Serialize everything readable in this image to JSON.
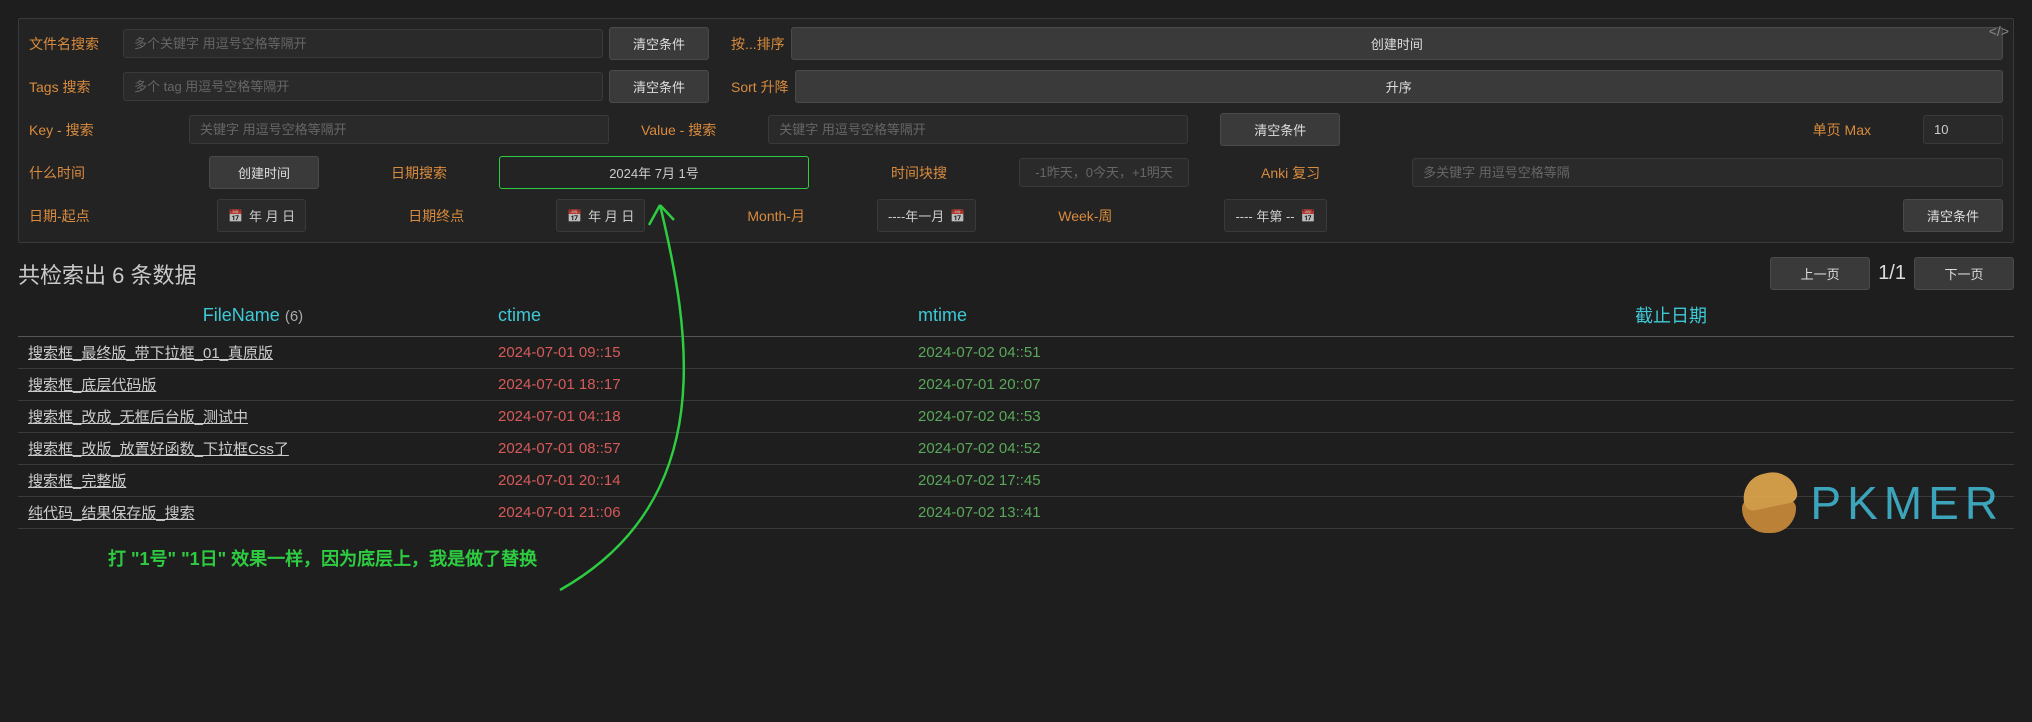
{
  "filters": {
    "filename_label": "文件名搜索",
    "filename_placeholder": "多个关键字 用逗号空格等隔开",
    "tags_label": "Tags 搜索",
    "tags_placeholder": "多个 tag 用逗号空格等隔开",
    "clear_btn": "清空条件",
    "sort_by_label": "按...排序",
    "sort_by_value": "创建时间",
    "sort_dir_label": "Sort 升降",
    "sort_dir_value": "升序",
    "key_label": "Key - 搜索",
    "key_placeholder": "关键字 用逗号空格等隔开",
    "value_label": "Value - 搜索",
    "value_placeholder": "关键字 用逗号空格等隔开",
    "page_max_label": "单页 Max",
    "page_max_value": "10",
    "what_time_label": "什么时间",
    "what_time_btn": "创建时间",
    "date_search_label": "日期搜索",
    "date_search_value": "2024年 7月 1号",
    "block_search_label": "时间块搜",
    "block_search_placeholder": "-1昨天，0今天，+1明天",
    "anki_label": "Anki 复习",
    "anki_placeholder": "多关键字 用逗号空格等隔",
    "date_start_label": "日期-起点",
    "date_start_value": "年 月 日",
    "date_end_label": "日期终点",
    "date_end_value": "年 月 日",
    "month_label": "Month-月",
    "month_value": "----年一月",
    "week_label": "Week-周",
    "week_value": "---- 年第 --"
  },
  "summary": {
    "prefix": "共检索出 ",
    "count": "6",
    "suffix": " 条数据",
    "prev": "上一页",
    "page": "1/1",
    "next": "下一页"
  },
  "table": {
    "headers": {
      "filename": "FileName",
      "filecount": "(6)",
      "ctime": "ctime",
      "mtime": "mtime",
      "deadline": "截止日期"
    },
    "rows": [
      {
        "name": "搜索框_最终版_带下拉框_01_真原版",
        "ctime": "2024-07-01 09::15",
        "mtime": "2024-07-02 04::51"
      },
      {
        "name": "搜索框_底层代码版",
        "ctime": "2024-07-01 18::17",
        "mtime": "2024-07-01 20::07"
      },
      {
        "name": "搜索框_改成_无框后台版_测试中",
        "ctime": "2024-07-01 04::18",
        "mtime": "2024-07-02 04::53"
      },
      {
        "name": "搜索框_改版_放置好函数_下拉框Css了",
        "ctime": "2024-07-01 08::57",
        "mtime": "2024-07-02 04::52"
      },
      {
        "name": "搜索框_完整版",
        "ctime": "2024-07-01 20::14",
        "mtime": "2024-07-02 17::45"
      },
      {
        "name": "纯代码_结果保存版_搜索",
        "ctime": "2024-07-01 21::06",
        "mtime": "2024-07-02 13::41"
      }
    ]
  },
  "annotation": "打 \"1号\" \"1日\" 效果一样，因为底层上，我是做了替换",
  "brand": "PKMER"
}
